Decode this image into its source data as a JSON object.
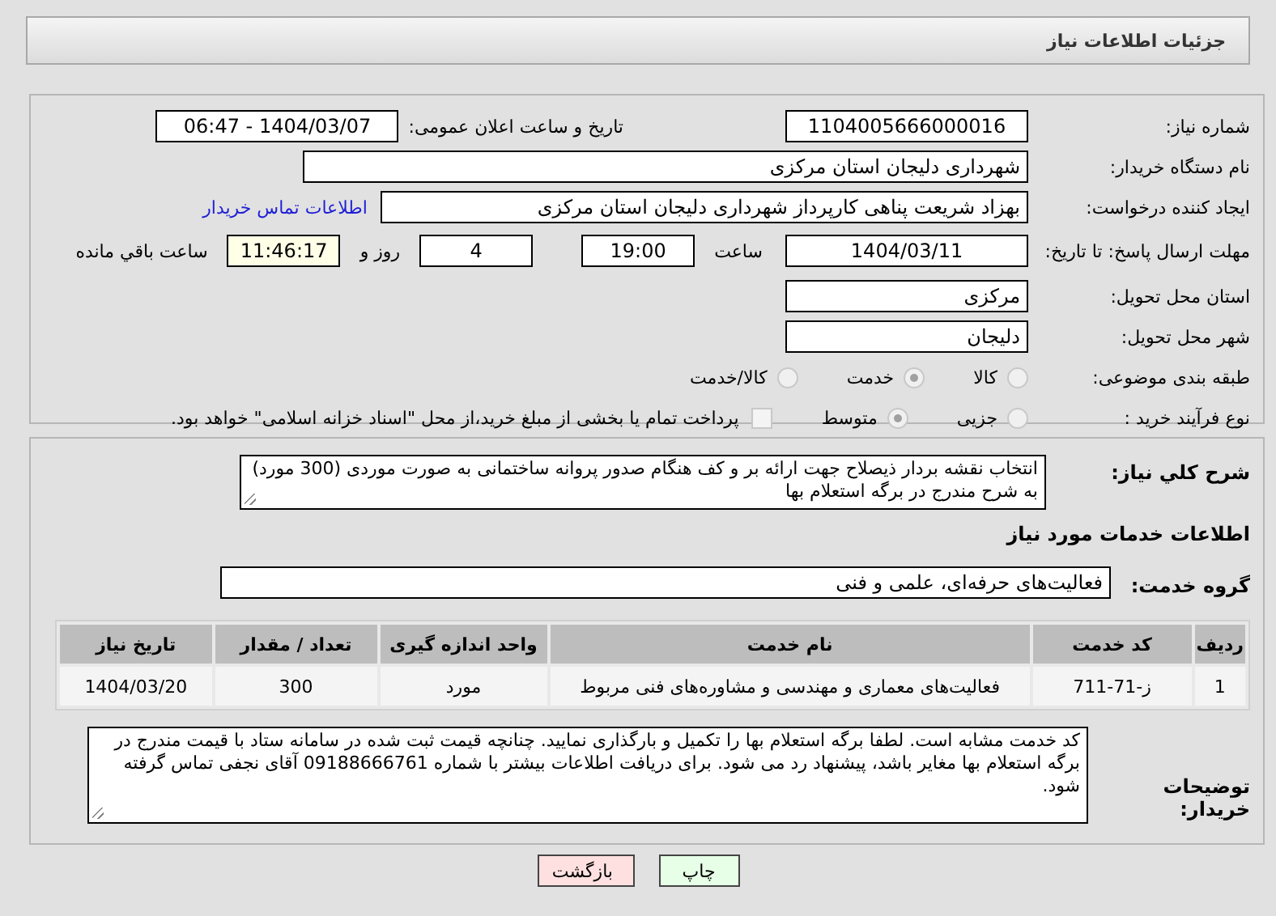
{
  "header": {
    "title": "جزئیات اطلاعات نیاز"
  },
  "need_number": {
    "label": "شماره نیاز:",
    "value": "1104005666000016"
  },
  "announce": {
    "label": "تاریخ و ساعت اعلان عمومی:",
    "value": "1404/03/07 - 06:47"
  },
  "buyer": {
    "label": "نام دستگاه خریدار:",
    "value": "شهرداری دلیجان استان مرکزی"
  },
  "creator": {
    "label": "ایجاد کننده درخواست:",
    "value": "بهزاد شریعت پناهی کارپرداز شهرداری دلیجان استان مرکزی",
    "link": "اطلاعات تماس خریدار"
  },
  "deadline": {
    "label": "مهلت ارسال پاسخ: تا تاریخ:",
    "date": "1404/03/11",
    "time_label": "ساعت",
    "time": "19:00",
    "days": "4",
    "days_label": "روز و",
    "remaining": "11:46:17",
    "remaining_label": "ساعت باقي مانده"
  },
  "province": {
    "label": "استان محل تحویل:",
    "value": "مرکزی"
  },
  "city": {
    "label": "شهر محل تحویل:",
    "value": "دلیجان"
  },
  "category": {
    "label": "طبقه بندی موضوعی:",
    "options": [
      {
        "label": "کالا",
        "selected": false
      },
      {
        "label": "خدمت",
        "selected": true
      },
      {
        "label": "کالا/خدمت",
        "selected": false
      }
    ]
  },
  "process": {
    "label": "نوع فرآیند خرید :",
    "options": [
      {
        "label": "جزیی",
        "selected": false
      },
      {
        "label": "متوسط",
        "selected": true
      }
    ],
    "treasury": {
      "label": "پرداخت تمام یا بخشی از مبلغ خرید،از محل \"اسناد خزانه اسلامی\" خواهد بود.",
      "checked": false
    }
  },
  "description": {
    "label": "شرح کلي نیاز:",
    "value": "انتخاب نقشه بردار ذیصلاح جهت ارائه بر و کف هنگام صدور پروانه ساختمانی به صورت موردی (300 مورد) به شرح مندرج در برگه استعلام بها"
  },
  "services_heading": "اطلاعات خدمات مورد نیاز",
  "service_group": {
    "label": "گروه خدمت:",
    "value": "فعالیت‌های حرفه‌ای، علمی و فنی"
  },
  "table": {
    "columns": [
      "ردیف",
      "کد خدمت",
      "نام خدمت",
      "واحد اندازه گیری",
      "تعداد / مقدار",
      "تاریخ نیاز"
    ],
    "rows": [
      [
        "1",
        "ز-71-711",
        "فعالیت‌های معماری و مهندسی و مشاوره‌های فنی مربوط",
        "مورد",
        "300",
        "1404/03/20"
      ]
    ]
  },
  "buyer_notes": {
    "label": "توضیحات خریدار:",
    "value": "کد خدمت مشابه است. لطفا برگه استعلام بها را تکمیل و بارگذاری نمایید. چنانچه قیمت ثبت شده در سامانه ستاد با قیمت مندرج در برگه استعلام بها مغایر باشد، پیشنهاد رد می شود. برای دریافت اطلاعات بیشتر با شماره 09188666761 آقای نجفی تماس گرفته شود."
  },
  "buttons": [
    {
      "label": "چاپ",
      "kind": "print"
    },
    {
      "label": "بازگشت",
      "kind": "back"
    }
  ]
}
